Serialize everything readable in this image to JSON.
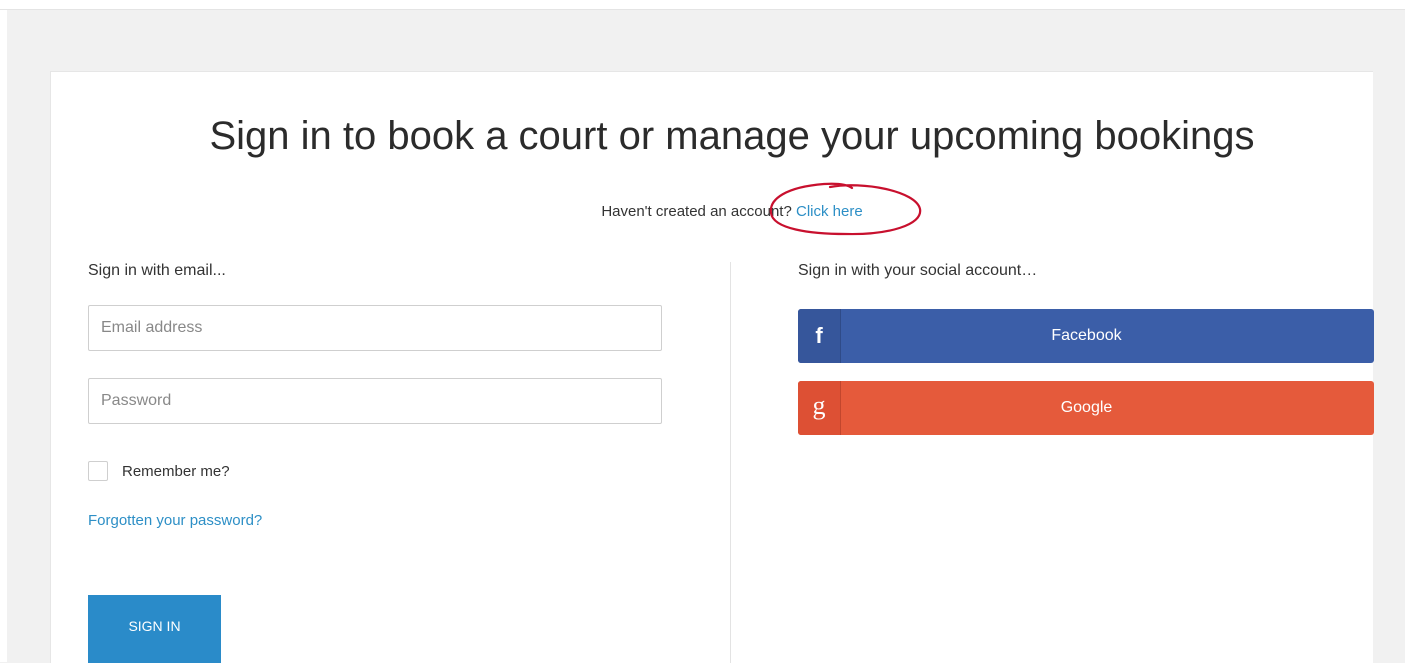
{
  "page": {
    "title": "Sign in to book a court or manage your upcoming bookings",
    "register_prompt": "Haven't created an account?",
    "register_link": "Click here"
  },
  "email_section": {
    "heading": "Sign in with email...",
    "email_placeholder": "Email address",
    "password_placeholder": "Password",
    "remember_label": "Remember me?",
    "forgot_link": "Forgotten your password?",
    "submit_label": "SIGN IN"
  },
  "social_section": {
    "heading": "Sign in with your social account…",
    "buttons": [
      {
        "label": "Facebook",
        "icon": "facebook-icon",
        "glyph": "f",
        "color": "#3b5ea8"
      },
      {
        "label": "Google",
        "icon": "google-icon",
        "glyph": "g",
        "color": "#e55a3b"
      }
    ]
  },
  "colors": {
    "link": "#2d8fc6",
    "primary_button": "#2a8bc9",
    "annotation": "#c8102e"
  }
}
